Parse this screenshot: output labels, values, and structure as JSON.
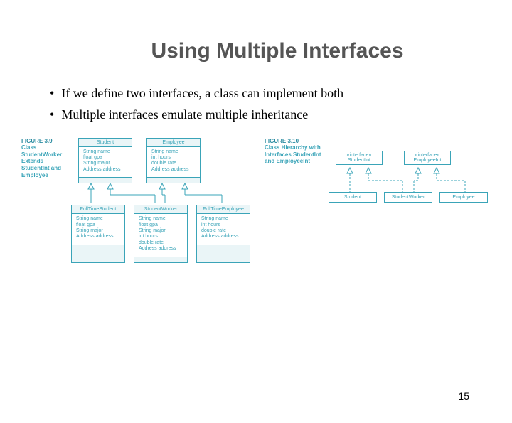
{
  "title": "Using Multiple Interfaces",
  "bullets": [
    "If we define two interfaces, a class can implement both",
    "Multiple interfaces emulate multiple inheritance"
  ],
  "figure_left": {
    "number": "FIGURE 3.9",
    "caption": "Class StudentWorker Extends StudentInt and Employee",
    "top_classes": [
      {
        "name": "Student",
        "attrs": [
          "String name",
          "float gpa",
          "String major",
          "Address address"
        ]
      },
      {
        "name": "Employee",
        "attrs": [
          "String name",
          "int hours",
          "double rate",
          "Address address"
        ]
      }
    ],
    "bottom_classes": [
      {
        "name": "FullTimeStudent",
        "attrs": [
          "String name",
          "float gpa",
          "String major",
          "Address address"
        ]
      },
      {
        "name": "StudentWorker",
        "attrs": [
          "String name",
          "float gpa",
          "String major",
          "int hours",
          "double rate",
          "Address address"
        ]
      },
      {
        "name": "FullTimeEmployee",
        "attrs": [
          "String name",
          "int hours",
          "double rate",
          "Address address"
        ]
      }
    ]
  },
  "figure_right": {
    "number": "FIGURE 3.10",
    "caption": "Class Hierarchy with Interfaces StudentInt and EmployeeInt",
    "interfaces": [
      {
        "stereo": "«interface»",
        "name": "StudentInt"
      },
      {
        "stereo": "«interface»",
        "name": "EmployeeInt"
      }
    ],
    "classes": [
      "Student",
      "StudentWorker",
      "Employee"
    ]
  },
  "page_number": "15"
}
